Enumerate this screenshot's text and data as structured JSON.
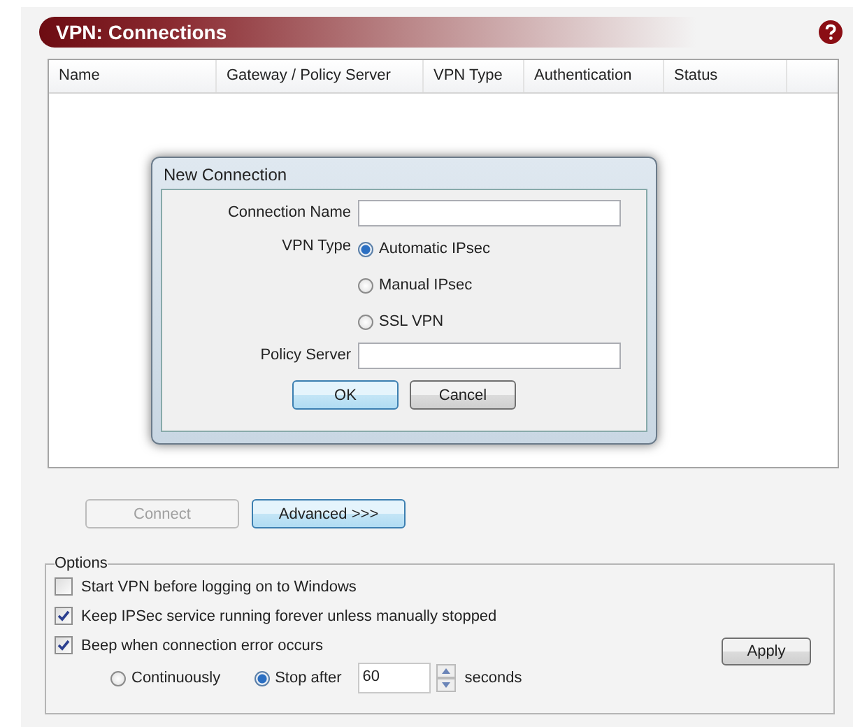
{
  "header": {
    "title": "VPN: Connections"
  },
  "table": {
    "columns": [
      "Name",
      "Gateway / Policy Server",
      "VPN Type",
      "Authentication",
      "Status"
    ]
  },
  "dialog": {
    "title": "New Connection",
    "connection_name_label": "Connection Name",
    "vpn_type_label": "VPN Type",
    "vpn_types": [
      {
        "label": "Automatic IPsec",
        "selected": true
      },
      {
        "label": "Manual IPsec",
        "selected": false
      },
      {
        "label": "SSL VPN",
        "selected": false
      }
    ],
    "policy_server_label": "Policy Server",
    "ok": "OK",
    "cancel": "Cancel"
  },
  "buttons": [
    {
      "label": "Connect",
      "disabled": true,
      "default": false
    },
    {
      "label": "Advanced >>>",
      "disabled": false,
      "default": true
    }
  ],
  "options": {
    "legend": "Options",
    "checkboxes": [
      {
        "label": "Start VPN before logging on to Windows",
        "checked": false
      },
      {
        "label": "Keep IPSec service running forever unless manually stopped",
        "checked": true
      },
      {
        "label": "Beep when connection error occurs",
        "checked": true
      }
    ],
    "beep_modes": [
      {
        "label": "Continuously",
        "selected": false
      },
      {
        "label": "Stop after",
        "selected": true
      }
    ],
    "stop_after_value": "60",
    "unit": "seconds",
    "apply": "Apply"
  }
}
